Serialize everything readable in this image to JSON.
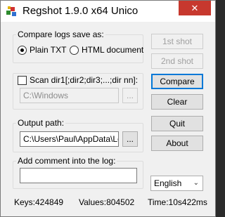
{
  "title_bar": {
    "title": "Regshot 1.9.0 x64 Unico",
    "close_glyph": "✕",
    "app_icon": "regshot-app-icon"
  },
  "compare_group": {
    "label": "Compare logs save as:",
    "options": [
      {
        "label": "Plain TXT",
        "selected": true
      },
      {
        "label": "HTML document",
        "selected": false
      }
    ]
  },
  "scan_group": {
    "checkbox_label": "Scan dir1[;dir2;dir3;...;dir nn]:",
    "checked": false,
    "dir_value": "C:\\Windows",
    "browse_label": "..."
  },
  "output_group": {
    "label": "Output path:",
    "path_value": "C:\\Users\\Paul\\AppData\\Loc",
    "browse_label": "..."
  },
  "comment_group": {
    "label": "Add comment into the log:",
    "comment_value": ""
  },
  "buttons": {
    "first_shot": "1st shot",
    "second_shot": "2nd shot",
    "compare": "Compare",
    "clear": "Clear",
    "quit": "Quit",
    "about": "About"
  },
  "language": {
    "selected": "English",
    "chevron_glyph": "⌄"
  },
  "status_bar": {
    "keys": "Keys:424849",
    "values": "Values:804502",
    "time": "Time:10s422ms"
  },
  "colors": {
    "accent": "#0078d7",
    "close_button": "#c7382e"
  }
}
